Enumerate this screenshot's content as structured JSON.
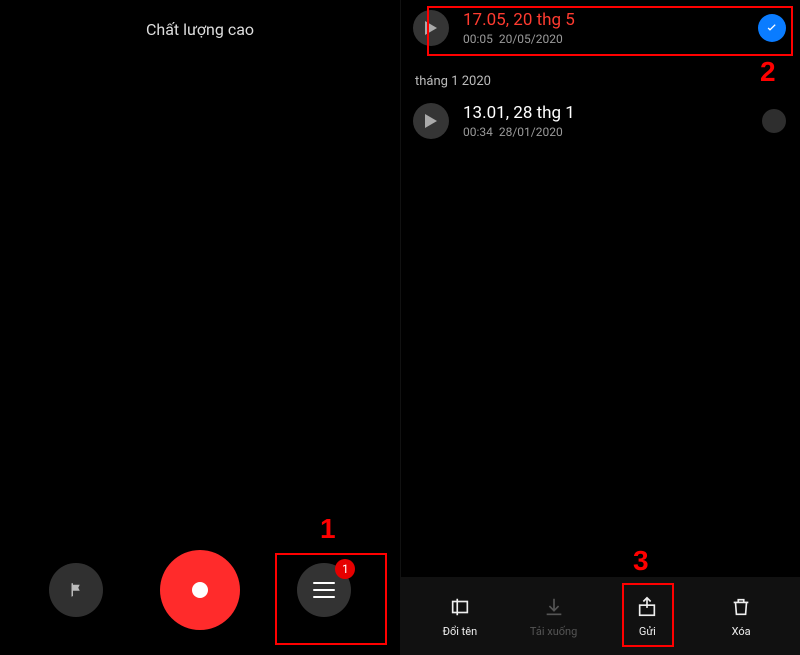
{
  "left": {
    "quality_label": "Chất lượng cao"
  },
  "annotations": {
    "one": "1",
    "two": "2",
    "three": "3"
  },
  "recordings": {
    "section1_header": "tháng 1 2020",
    "items": [
      {
        "title": "17.05, 20 thg 5",
        "duration": "00:05",
        "date": "20/05/2020",
        "selected": true
      },
      {
        "title": "13.01, 28 thg 1",
        "duration": "00:34",
        "date": "28/01/2020",
        "selected": false
      }
    ]
  },
  "bottom_bar": {
    "rename": "Đổi tên",
    "download": "Tải xuống",
    "send": "Gửi",
    "delete": "Xóa"
  },
  "list_badge": "1"
}
